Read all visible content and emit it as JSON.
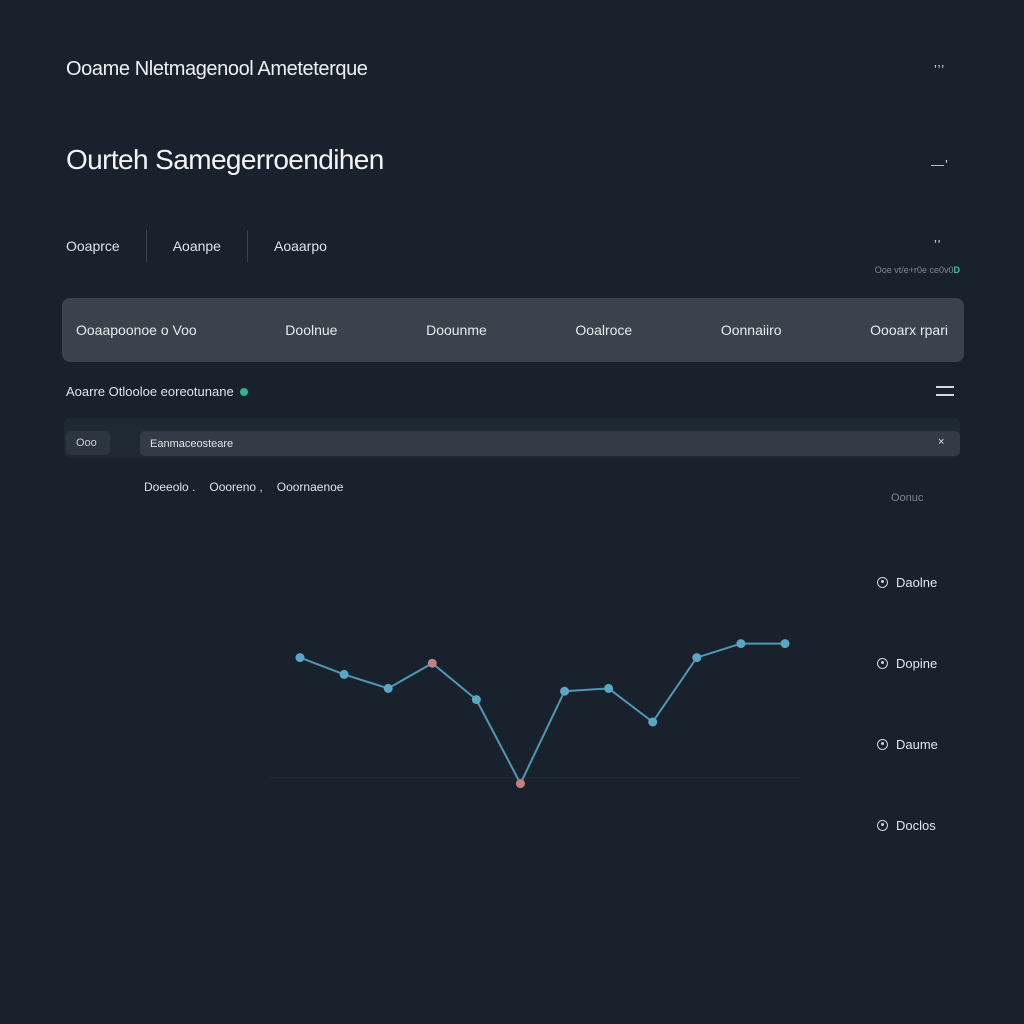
{
  "app": {
    "title": "Ooame Nletmagenool Ameteterque"
  },
  "header": {
    "page_title": "Ourteh Samegerroendihen",
    "corner_glyph_1": "’’’",
    "corner_glyph_2": "—’",
    "corner_glyph_3": "’'"
  },
  "tabs": [
    {
      "label": "Ooaprce"
    },
    {
      "label": "Aoanpe"
    },
    {
      "label": "Aoaarpo"
    }
  ],
  "status_small": {
    "text": "Ooe vt/e+r0e ce0v0",
    "tag": "D"
  },
  "table_header": {
    "columns": [
      {
        "label": "Ooaapoonoe o Voo"
      },
      {
        "label": "Doolnue"
      },
      {
        "label": "Doounme"
      },
      {
        "label": "Ooalroce"
      },
      {
        "label": "Oonnaiiro"
      },
      {
        "label": "Oooarx rpari"
      }
    ]
  },
  "section": {
    "label": "Aoarre Otlooloe eoreotunane"
  },
  "filter": {
    "chip_label": "Ooo",
    "search_value": "Eanmaceosteare",
    "clear_glyph": "×"
  },
  "chart_legend": [
    {
      "label": "Doeeolo ."
    },
    {
      "label": "Oooreno ,"
    },
    {
      "label": "Ooornaenoe"
    }
  ],
  "side_panel": {
    "top_label": "Oonuc",
    "items": [
      {
        "label": "Daolne"
      },
      {
        "label": "Dopine"
      },
      {
        "label": "Daume"
      },
      {
        "label": "Doclos"
      }
    ]
  },
  "colors": {
    "background": "#19222c",
    "line": "#4f97b3",
    "point": "#5aa6c3",
    "point_highlight": "#c0827e",
    "accent_green": "#2ec99a"
  },
  "chart_data": {
    "type": "line",
    "x": [
      1,
      2,
      3,
      4,
      5,
      6,
      7,
      8,
      9,
      10,
      11,
      12
    ],
    "series": [
      {
        "values": [
          58,
          52,
          47,
          56,
          43,
          13,
          46,
          47,
          35,
          58,
          63,
          63
        ],
        "highlighted_indices": [
          3,
          5
        ]
      }
    ],
    "ylim": [
      0,
      100
    ],
    "grid": false
  }
}
